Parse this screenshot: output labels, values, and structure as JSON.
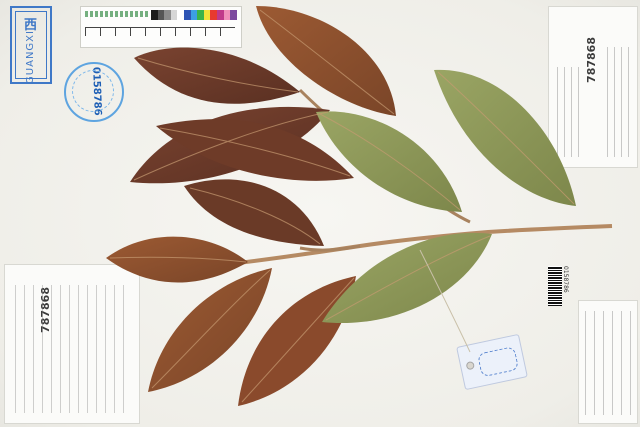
{
  "specimen": {
    "stamp_region": {
      "char": "西",
      "text": "GUANGXI"
    },
    "round_stamp": {
      "number": "0158786",
      "ring_text": "广西植物研究所标本馆"
    },
    "number_top_right": "787868",
    "number_bottom_label": "787868",
    "barcode_number": "0158786",
    "tag_code": "IBK"
  },
  "colors": {
    "leaf_dark": "#6a3a28",
    "leaf_brown": "#8b4a2b",
    "leaf_olive": "#8f9a5a",
    "stem": "#b58a63",
    "paper": "#f4f3ee",
    "stamp_blue": "#3f78c7"
  },
  "scale_bar": {
    "swatches": [
      "#1b1b1b",
      "#555555",
      "#8b8b8b",
      "#d6d6d6",
      "#ffffff",
      "#2f55b5",
      "#3c9fe3",
      "#3bb34a",
      "#f2e23a",
      "#e83a2f",
      "#c0398a",
      "#f08fba",
      "#7d4a9e"
    ]
  }
}
